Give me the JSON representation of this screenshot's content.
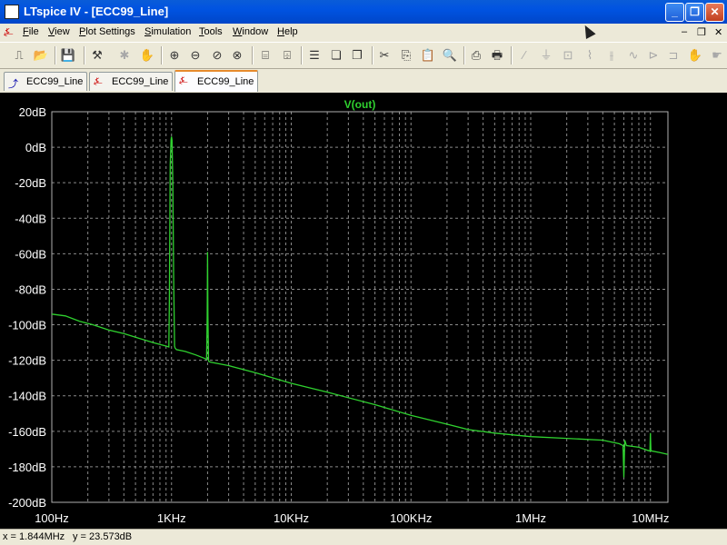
{
  "window": {
    "title": "LTspice IV - [ECC99_Line]",
    "minimize": "_",
    "restore": "❐",
    "close": "✕"
  },
  "menu": [
    "File",
    "View",
    "Plot Settings",
    "Simulation",
    "Tools",
    "Window",
    "Help"
  ],
  "mdi": {
    "minimize": "–",
    "restore": "❐",
    "close": "✕"
  },
  "toolbar": [
    {
      "icon": "schematic-icon",
      "glyph": "⎍",
      "enabled": true
    },
    {
      "icon": "open-icon",
      "glyph": "📂",
      "enabled": true
    },
    {
      "icon": "save-icon",
      "glyph": "💾",
      "enabled": true
    },
    {
      "icon": "control-panel-icon",
      "glyph": "⚒",
      "enabled": true
    },
    {
      "icon": "run-icon",
      "glyph": "✱",
      "enabled": false
    },
    {
      "icon": "pan-icon",
      "glyph": "✋",
      "enabled": false
    },
    {
      "icon": "zoom-in-icon",
      "glyph": "⊕",
      "enabled": true
    },
    {
      "icon": "zoom-out-icon",
      "glyph": "⊖",
      "enabled": true
    },
    {
      "icon": "zoom-back-icon",
      "glyph": "⊘",
      "enabled": true
    },
    {
      "icon": "zoom-fit-icon",
      "glyph": "⊗",
      "enabled": true
    },
    {
      "icon": "autorange-icon",
      "glyph": "⌸",
      "enabled": true
    },
    {
      "icon": "fit-icon",
      "glyph": "⌹",
      "enabled": true
    },
    {
      "icon": "tile-horizontal-icon",
      "glyph": "☰",
      "enabled": true
    },
    {
      "icon": "cascade-icon",
      "glyph": "❏",
      "enabled": true
    },
    {
      "icon": "tile-vertical-icon",
      "glyph": "❐",
      "enabled": true
    },
    {
      "icon": "cut-icon",
      "glyph": "✂",
      "enabled": true
    },
    {
      "icon": "copy-icon",
      "glyph": "⎘",
      "enabled": true
    },
    {
      "icon": "paste-icon",
      "glyph": "📋",
      "enabled": true
    },
    {
      "icon": "find-icon",
      "glyph": "🔍",
      "enabled": true
    },
    {
      "icon": "print-setup-icon",
      "glyph": "⎙",
      "enabled": true
    },
    {
      "icon": "print-icon",
      "glyph": "🖶",
      "enabled": true
    },
    {
      "icon": "wire-icon",
      "glyph": "∕",
      "enabled": false
    },
    {
      "icon": "ground-icon",
      "glyph": "⏚",
      "enabled": false
    },
    {
      "icon": "label-icon",
      "glyph": "⊡",
      "enabled": false
    },
    {
      "icon": "resistor-icon",
      "glyph": "⌇",
      "enabled": false
    },
    {
      "icon": "capacitor-icon",
      "glyph": "⫲",
      "enabled": false
    },
    {
      "icon": "inductor-icon",
      "glyph": "∿",
      "enabled": false
    },
    {
      "icon": "diode-icon",
      "glyph": "⊳",
      "enabled": false
    },
    {
      "icon": "component-icon",
      "glyph": "⊐",
      "enabled": false
    },
    {
      "icon": "move-icon",
      "glyph": "✋",
      "enabled": false
    },
    {
      "icon": "drag-icon",
      "glyph": "☛",
      "enabled": false
    }
  ],
  "tabs": [
    {
      "label": "ECC99_Line",
      "icon": "schematic-tab-icon",
      "active": false
    },
    {
      "label": "ECC99_Line",
      "icon": "waveform-tab-icon",
      "active": false
    },
    {
      "label": "ECC99_Line",
      "icon": "waveform-tab-icon",
      "active": true
    }
  ],
  "status": {
    "x": "x = 1.844MHz",
    "y": "y = 23.573dB"
  },
  "colors": {
    "trace": "#2fd12f",
    "grid": "#8a8a8a",
    "axis_text": "#ffffff",
    "background": "#000000",
    "title": "#2fd12f"
  },
  "chart_data": {
    "type": "line",
    "title": "V(out)",
    "x_scale": "log",
    "xlim": [
      100,
      14000000
    ],
    "ylim": [
      -200,
      20
    ],
    "x_ticks": [
      {
        "v": 100,
        "label": "100Hz"
      },
      {
        "v": 1000,
        "label": "1KHz"
      },
      {
        "v": 10000,
        "label": "10KHz"
      },
      {
        "v": 100000,
        "label": "100KHz"
      },
      {
        "v": 1000000,
        "label": "1MHz"
      },
      {
        "v": 10000000,
        "label": "10MHz"
      }
    ],
    "y_ticks": [
      {
        "v": 20,
        "label": "20dB"
      },
      {
        "v": 0,
        "label": "0dB"
      },
      {
        "v": -20,
        "label": "-20dB"
      },
      {
        "v": -40,
        "label": "-40dB"
      },
      {
        "v": -60,
        "label": "-60dB"
      },
      {
        "v": -80,
        "label": "-80dB"
      },
      {
        "v": -100,
        "label": "-100dB"
      },
      {
        "v": -120,
        "label": "-120dB"
      },
      {
        "v": -140,
        "label": "-140dB"
      },
      {
        "v": -160,
        "label": "-160dB"
      },
      {
        "v": -180,
        "label": "-180dB"
      },
      {
        "v": -200,
        "label": "-200dB"
      }
    ],
    "grid": true,
    "series": [
      {
        "name": "V(out)",
        "points": [
          [
            100,
            -94
          ],
          [
            130,
            -95
          ],
          [
            170,
            -98
          ],
          [
            220,
            -100
          ],
          [
            300,
            -103
          ],
          [
            400,
            -105
          ],
          [
            500,
            -107
          ],
          [
            700,
            -110
          ],
          [
            900,
            -112
          ],
          [
            950,
            -112.5
          ],
          [
            960,
            -85
          ],
          [
            975,
            -10
          ],
          [
            990,
            4
          ],
          [
            1000,
            6
          ],
          [
            1010,
            4
          ],
          [
            1025,
            -20
          ],
          [
            1040,
            -70
          ],
          [
            1060,
            -112
          ],
          [
            1070,
            -113
          ],
          [
            1100,
            -114
          ],
          [
            1300,
            -115
          ],
          [
            1600,
            -117
          ],
          [
            1900,
            -119
          ],
          [
            1960,
            -119.5
          ],
          [
            1985,
            -95
          ],
          [
            2000,
            -59
          ],
          [
            2015,
            -95
          ],
          [
            2040,
            -120.5
          ],
          [
            2100,
            -121
          ],
          [
            3000,
            -123
          ],
          [
            5000,
            -127
          ],
          [
            10000,
            -133
          ],
          [
            20000,
            -138
          ],
          [
            50000,
            -145
          ],
          [
            100000,
            -151
          ],
          [
            200000,
            -156
          ],
          [
            300000,
            -159
          ],
          [
            500000,
            -161
          ],
          [
            1000000,
            -163
          ],
          [
            2000000,
            -164
          ],
          [
            4000000,
            -165
          ],
          [
            5500000,
            -167
          ],
          [
            5900000,
            -168
          ],
          [
            6000000,
            -186
          ],
          [
            6100000,
            -165
          ],
          [
            6300000,
            -168
          ],
          [
            8000000,
            -169
          ],
          [
            9700000,
            -171
          ],
          [
            9900000,
            -171
          ],
          [
            10000000,
            -161
          ],
          [
            10100000,
            -171
          ],
          [
            12000000,
            -172
          ],
          [
            14000000,
            -173
          ]
        ]
      }
    ]
  }
}
